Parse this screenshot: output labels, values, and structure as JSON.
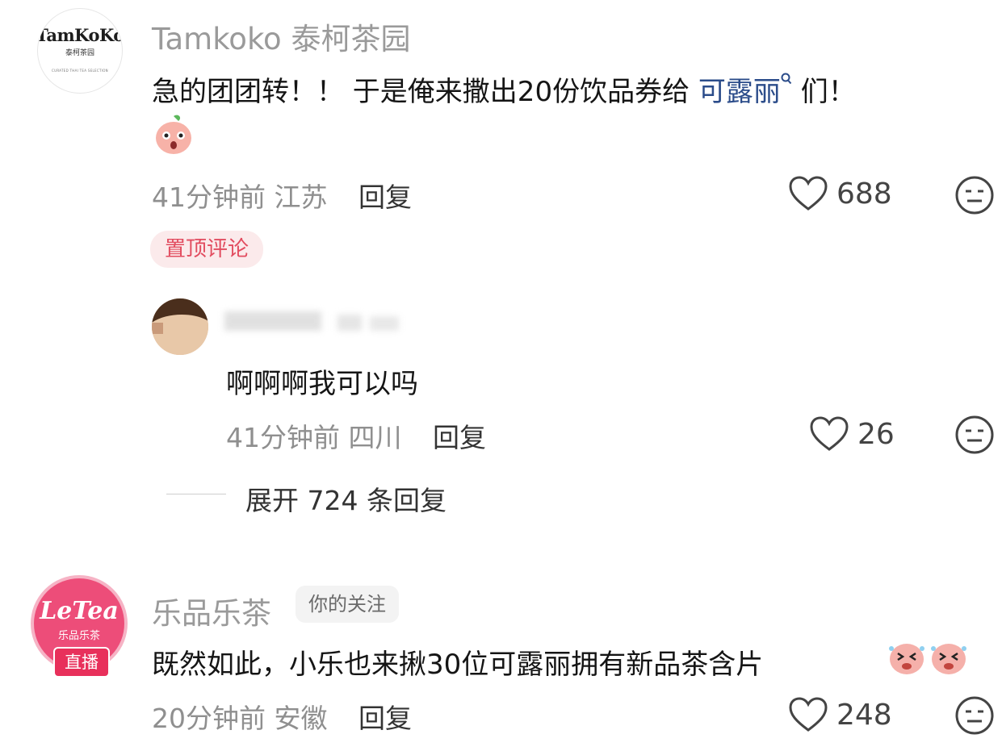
{
  "comments": [
    {
      "username": "Tamkoko 泰柯茶园",
      "avatar_text": "TamKoKo",
      "avatar_subtext": "泰柯茶园",
      "avatar_tiny": "CURATED THAI TEA SELECTION",
      "text_before": "急的团团转！！ 于是俺来撒出20份饮品券给 ",
      "mention": "可露丽",
      "text_after": " 们！",
      "time": "41分钟前",
      "location": "江苏",
      "reply_label": "回复",
      "likes": "688",
      "pinned_label": "置顶评论",
      "sticker_icon": "pink-face-sticker-icon",
      "replies": [
        {
          "text": "啊啊啊我可以吗",
          "time": "41分钟前",
          "location": "四川",
          "reply_label": "回复",
          "likes": "26"
        }
      ],
      "expand_label": "展开 724 条回复"
    },
    {
      "username": "乐品乐茶",
      "follow_badge": "你的关注",
      "avatar_text": "LeTea",
      "avatar_subtext": "乐品乐茶",
      "live_badge": "直播",
      "text": "既然如此，小乐也来揪30位可露丽拥有新品茶含片",
      "time": "20分钟前",
      "location": "安徽",
      "reply_label": "回复",
      "likes": "248"
    }
  ],
  "colors": {
    "mention": "#2b4c8a",
    "pinned_bg": "#fbeaeb",
    "pinned_text": "#e24c5f",
    "live_badge": "#e8305b",
    "letea_avatar": "#ed4d79"
  }
}
